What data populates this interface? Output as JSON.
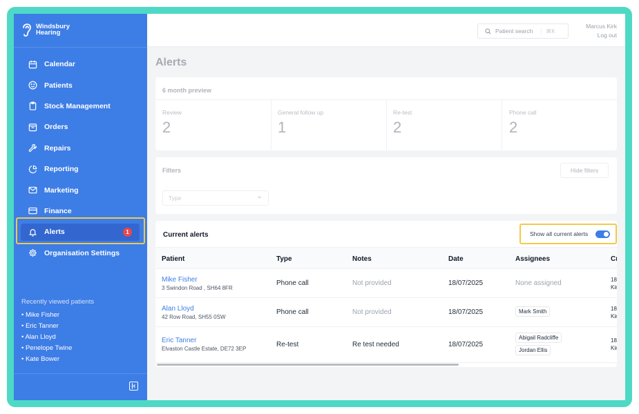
{
  "brand": {
    "line1": "Windsbury",
    "line2": "Hearing"
  },
  "nav": [
    {
      "label": "Calendar",
      "icon": "calendar-icon"
    },
    {
      "label": "Patients",
      "icon": "smiley-icon"
    },
    {
      "label": "Stock Management",
      "icon": "clipboard-icon"
    },
    {
      "label": "Orders",
      "icon": "box-icon"
    },
    {
      "label": "Repairs",
      "icon": "wrench-icon"
    },
    {
      "label": "Reporting",
      "icon": "pie-chart-icon"
    },
    {
      "label": "Marketing",
      "icon": "mail-icon"
    },
    {
      "label": "Finance",
      "icon": "credit-card-icon"
    },
    {
      "label": "Alerts",
      "icon": "bell-icon",
      "badge": "1",
      "active": true
    },
    {
      "label": "Organisation Settings",
      "icon": "gear-icon"
    }
  ],
  "recent": {
    "title": "Recently viewed patients",
    "items": [
      "• Mike Fisher",
      "• Eric Tanner",
      "• Alan Lloyd",
      "• Penelope Twine",
      "• Kate Bower"
    ]
  },
  "topbar": {
    "search_placeholder": "Patient search",
    "search_shortcut": "⌘K",
    "user_name": "Marcus Kirk",
    "logout": "Log out"
  },
  "page_title": "Alerts",
  "preview": {
    "title": "6 month preview",
    "stats": [
      {
        "label": "Review",
        "value": "2"
      },
      {
        "label": "General follow up",
        "value": "1"
      },
      {
        "label": "Re-test",
        "value": "2"
      },
      {
        "label": "Phone call",
        "value": "2"
      }
    ]
  },
  "filters": {
    "title": "Filters",
    "hide_label": "Hide filters",
    "type_placeholder": "Type"
  },
  "alerts": {
    "title": "Current alerts",
    "toggle_label": "Show all current alerts",
    "toggle_on": true,
    "columns": [
      "Patient",
      "Type",
      "Notes",
      "Date",
      "Assignees",
      "Cr"
    ],
    "rows": [
      {
        "name": "Mike Fisher",
        "address": "3 Swindon Road , SH64 8FR",
        "type": "Phone call",
        "notes": "Not provided",
        "notes_muted": true,
        "date": "18/07/2025",
        "assignees": [],
        "assignees_empty": "None assigned",
        "created1": "18/",
        "created2": "Kir"
      },
      {
        "name": "Alan Lloyd",
        "address": "42 Row Road, SH55 0SW",
        "type": "Phone call",
        "notes": "Not provided",
        "notes_muted": true,
        "date": "18/07/2025",
        "assignees": [
          "Mark Smith"
        ],
        "created1": "18/",
        "created2": "Kir"
      },
      {
        "name": "Eric Tanner",
        "address": "Elvaston Castle Estate, DE72 3EP",
        "type": "Re-test",
        "notes": "Re test needed",
        "notes_muted": false,
        "date": "18/07/2025",
        "assignees": [
          "Abigail Radcliffe",
          "Jordan Ellis"
        ],
        "created1": "18/",
        "created2": "Kir"
      }
    ]
  },
  "colors": {
    "sidebar": "#3d7de6",
    "accent": "#3d7de6",
    "badge": "#e8474c",
    "highlight": "#f2c94c",
    "frame": "#4dd9c5"
  }
}
